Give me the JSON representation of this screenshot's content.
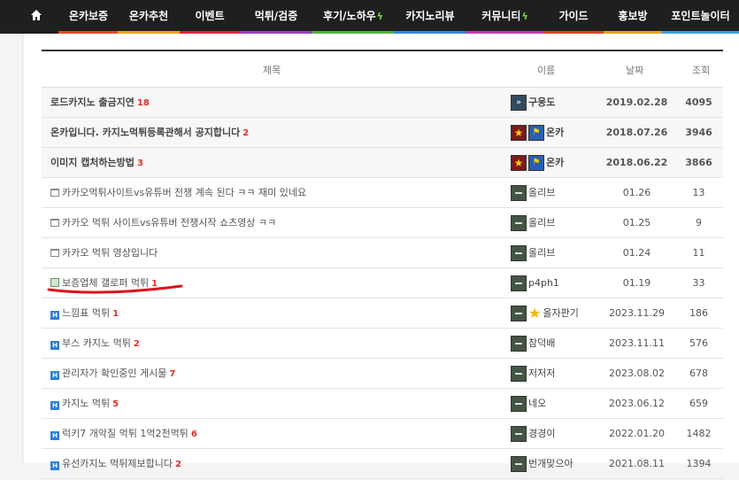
{
  "nav": {
    "items": [
      {
        "label": "온카보증",
        "color": "#e8462a",
        "bolt": false
      },
      {
        "label": "온카추천",
        "color": "#f0a21a",
        "bolt": false
      },
      {
        "label": "이벤트",
        "color": "#e0243d",
        "bolt": false
      },
      {
        "label": "먹튀/검증",
        "color": "#9a3fb8",
        "bolt": false,
        "active": true
      },
      {
        "label": "후기/노하우",
        "color": "#53b33f",
        "bolt": true
      },
      {
        "label": "카지노리뷰",
        "color": "#2f88d8",
        "bolt": false
      },
      {
        "label": "커뮤니티",
        "color": "#c13da8",
        "bolt": true
      },
      {
        "label": "가이드",
        "color": "#d9442a",
        "bolt": false
      },
      {
        "label": "홍보방",
        "color": "#e3a21c",
        "bolt": false
      },
      {
        "label": "포인트놀이터",
        "color": "#3aa3d8",
        "bolt": false
      }
    ]
  },
  "table": {
    "headers": {
      "title": "제목",
      "name": "이름",
      "date": "날짜",
      "views": "조회"
    },
    "rows": [
      {
        "type": "notice",
        "icon": "",
        "title": "로드카지노 출금지연",
        "count": "18",
        "badges": [
          "chev"
        ],
        "name": "구웅도",
        "date": "2019.02.28",
        "views": "4095"
      },
      {
        "type": "notice",
        "icon": "",
        "title": "온카입니다. 카지노먹튀등록관해서 공지합니다",
        "count": "2",
        "badges": [
          "star",
          "flag"
        ],
        "name": "온카",
        "date": "2018.07.26",
        "views": "3946"
      },
      {
        "type": "notice",
        "icon": "",
        "title": "이미지 캡처하는방법",
        "count": "3",
        "badges": [
          "star",
          "flag"
        ],
        "name": "온카",
        "date": "2018.06.22",
        "views": "3866"
      },
      {
        "type": "normal",
        "icon": "tv",
        "title": "카카오먹튀사이트vs유튜버 전쟁 계속 된다 ㅋㅋ 재미 있네요",
        "count": "",
        "badges": [
          "rank"
        ],
        "name": "올리브",
        "date": "01.26",
        "views": "13"
      },
      {
        "type": "normal",
        "icon": "tv",
        "title": "카카오 먹튀 사이트vs유튜버 전쟁시작 쇼츠영상 ㅋㅋ",
        "count": "",
        "badges": [
          "rank"
        ],
        "name": "올리브",
        "date": "01.25",
        "views": "9"
      },
      {
        "type": "normal",
        "icon": "tv",
        "title": "카카오 먹튀 영상입니다",
        "count": "",
        "badges": [
          "rank"
        ],
        "name": "올리브",
        "date": "01.24",
        "views": "11"
      },
      {
        "type": "normal",
        "icon": "img",
        "title": "보증업체 갤로퍼 먹튀",
        "count": "1",
        "badges": [
          "rank"
        ],
        "name": "p4ph1",
        "date": "01.19",
        "views": "33"
      },
      {
        "type": "normal",
        "icon": "h",
        "title": "느낌표 먹튀",
        "count": "1",
        "badges": [
          "rank",
          "gold"
        ],
        "name": "올자판기",
        "date": "2023.11.29",
        "views": "186"
      },
      {
        "type": "normal",
        "icon": "h",
        "title": "부스 카지노 먹튀",
        "count": "2",
        "badges": [
          "rank"
        ],
        "name": "참덕배",
        "date": "2023.11.11",
        "views": "576"
      },
      {
        "type": "normal",
        "icon": "h",
        "title": "관리자가 확인중인 게시물",
        "count": "7",
        "badges": [
          "rank"
        ],
        "name": "저저저",
        "date": "2023.08.02",
        "views": "678"
      },
      {
        "type": "normal",
        "icon": "h",
        "title": "카지노 먹튀",
        "count": "5",
        "badges": [
          "rank"
        ],
        "name": "네오",
        "date": "2023.06.12",
        "views": "659"
      },
      {
        "type": "normal",
        "icon": "h",
        "title": "럭키7 개악질 먹튀 1억2천먹튀",
        "count": "6",
        "badges": [
          "rank"
        ],
        "name": "경경이",
        "date": "2022.01.20",
        "views": "1482"
      },
      {
        "type": "normal",
        "icon": "h",
        "title": "유선카지노 먹튀제보합니다",
        "count": "2",
        "badges": [
          "rank"
        ],
        "name": "번개맞으아",
        "date": "2021.08.11",
        "views": "1394"
      }
    ]
  },
  "colors": {
    "annotation": "#e0121b"
  }
}
